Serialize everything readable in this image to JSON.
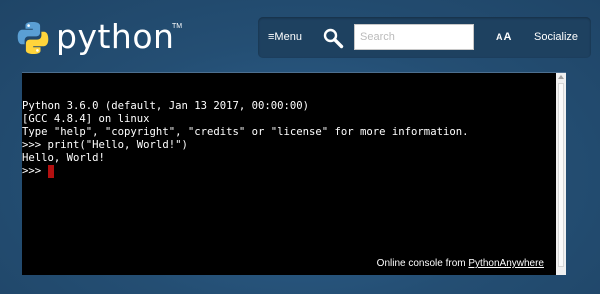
{
  "header": {
    "logo_text": "python",
    "logo_tm": "TM",
    "logo_icon": "python-logo-icon"
  },
  "toolbar": {
    "menu_icon": "hamburger-icon",
    "menu_label": "Menu",
    "search_icon": "magnifier-icon",
    "search_placeholder": "Search",
    "search_value": "",
    "text_size_label_large": "A",
    "text_size_label_small": "A",
    "socialize_label": "Socialize"
  },
  "console": {
    "lines": [
      "Python 3.6.0 (default, Jan 13 2017, 00:00:00)",
      "[GCC 4.8.4] on linux",
      "Type \"help\", \"copyright\", \"credits\" or \"license\" for more information.",
      ">>> print(\"Hello, World!\")",
      "Hello, World!"
    ],
    "prompt": ">>> ",
    "credit_prefix": "Online console from ",
    "credit_link": "PythonAnywhere"
  },
  "colors": {
    "background": "#2b5b84",
    "toolbar": "#1e4160",
    "console_bg": "#000000",
    "cursor": "#b31010"
  }
}
